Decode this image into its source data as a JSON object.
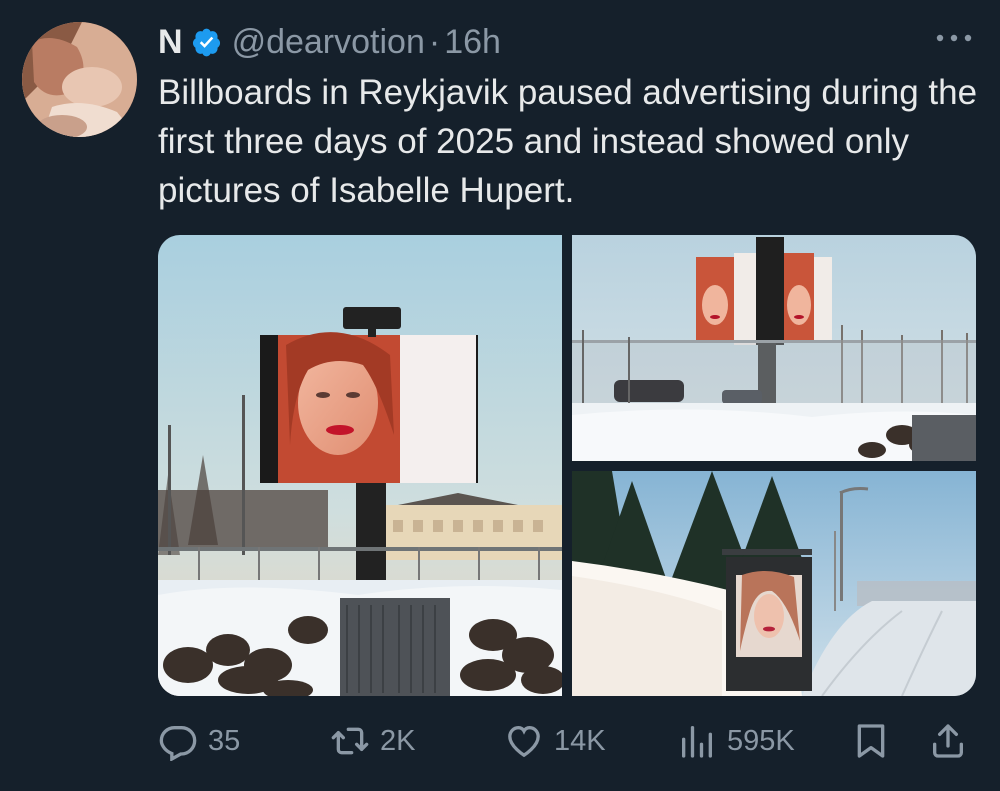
{
  "tweet": {
    "display_name": "N",
    "handle": "@dearvotion",
    "separator": "·",
    "time": "16h",
    "text": "Billboards in Reykjavik paused advertising during the first three days of 2025 and instead showed only pictures of Isabelle Hupert."
  },
  "media": {
    "images": [
      {
        "subject": "billboard-with-portrait"
      },
      {
        "subject": "rotating-billboard-tower"
      },
      {
        "subject": "bus-stop-poster"
      }
    ]
  },
  "actions": {
    "replies": "35",
    "reposts": "2K",
    "likes": "14K",
    "views": "595K"
  },
  "colors": {
    "background": "#15202b",
    "text": "#e7e9ea",
    "muted": "#8b98a5",
    "verified": "#1d9bf0"
  }
}
